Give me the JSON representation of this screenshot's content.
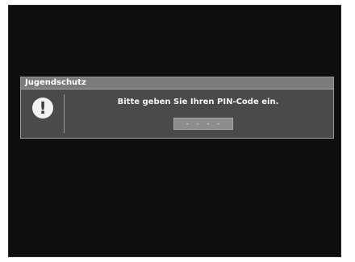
{
  "dialog": {
    "title": "Jugendschutz",
    "message": "Bitte geben Sie Ihren PIN-Code ein.",
    "pin_value": "- - - -",
    "icon": "exclamation-icon"
  },
  "colors": {
    "screen_background": "#0e0e0e",
    "dialog_background": "#4a4a4a",
    "title_bar": "#7b7b7b",
    "pin_field": "#8d8d8d"
  }
}
